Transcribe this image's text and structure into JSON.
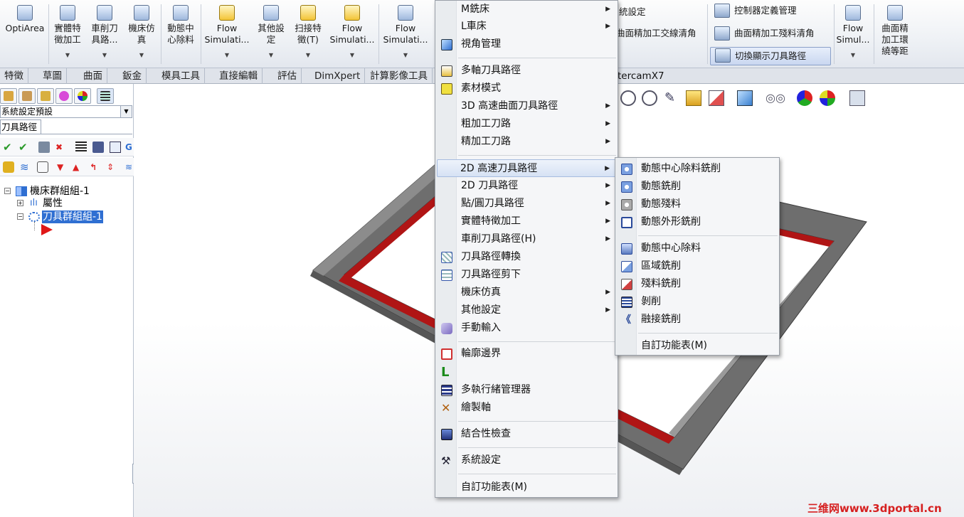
{
  "colors": {
    "accent": "#2f6fd2",
    "menu_bg": "#f5f6f8",
    "highlight": "#d6e2f4",
    "part_gray": "#7a7a7a",
    "part_red": "#a01818"
  },
  "ribbon": {
    "buttons": [
      {
        "label": "OptiArea",
        "icon": "optiarea-icon"
      },
      {
        "label": "實體特\n徵加工",
        "icon": "solid-feature-icon"
      },
      {
        "label": "車削刀\n具路...",
        "icon": "lathe-toolpath-icon"
      },
      {
        "label": "機床仿\n真",
        "icon": "machine-sim-icon"
      },
      {
        "label": "動態中\n心除料",
        "icon": "dynamic-core-icon"
      },
      {
        "label": "Flow\nSimulati...",
        "icon": "flow-sim-icon"
      },
      {
        "label": "其他設\n定",
        "icon": "other-settings-icon"
      },
      {
        "label": "扫接特\n徵(T)",
        "icon": "sweep-feature-icon"
      },
      {
        "label": "Flow\nSimulati...",
        "icon": "flow-sim-2-icon"
      },
      {
        "label": "Flow\nSimulati...",
        "icon": "flow-sim-3-icon"
      }
    ],
    "right_items": [
      {
        "label": "統設定"
      },
      {
        "label": "曲面精加工交線清角"
      },
      {
        "label": "控制器定義管理"
      },
      {
        "label": "曲面精加工殘料清角"
      },
      {
        "label": "切換顯示刀具路徑"
      }
    ],
    "right_buttons": [
      {
        "label": "Flow\nSimul..."
      },
      {
        "label": "曲面精\n加工環\n繞等距"
      }
    ]
  },
  "tabs": [
    "特徵",
    "草圖",
    "曲面",
    "鈑金",
    "模具工具",
    "直接編輯",
    "評估",
    "DimXpert",
    "計算影像工具"
  ],
  "viewport_tab": "tercamX7",
  "left_panel": {
    "dropdown": "系統設定預設",
    "subtab": "刀具路徑",
    "tree": [
      {
        "label": "機床群組組-1",
        "expander": "-"
      },
      {
        "label": "屬性",
        "expander": "+"
      },
      {
        "label": "刀具群組組-1",
        "expander": "-"
      }
    ]
  },
  "main_menu": {
    "items": [
      {
        "label": "M銑床",
        "submenu": true
      },
      {
        "label": "L車床",
        "submenu": true
      },
      {
        "label": "視角管理",
        "submenu": false,
        "icon": "cube-icon"
      },
      {
        "label": "多軸刀具路徑",
        "submenu": false,
        "icon": "multiaxis-icon"
      },
      {
        "label": "素材模式",
        "submenu": false,
        "icon": "stock-icon"
      },
      {
        "label": "3D 高速曲面刀具路徑",
        "submenu": true
      },
      {
        "label": "粗加工刀路",
        "submenu": true
      },
      {
        "label": "精加工刀路",
        "submenu": true
      },
      {
        "label": "2D 高速刀具路徑",
        "submenu": true
      },
      {
        "label": "2D 刀具路徑",
        "submenu": true
      },
      {
        "label": "點/圓刀具路徑",
        "submenu": true
      },
      {
        "label": "實體特徵加工",
        "submenu": true
      },
      {
        "label": "車削刀具路徑(H)",
        "submenu": true
      },
      {
        "label": "刀具路徑轉換",
        "submenu": false,
        "icon": "transform-icon"
      },
      {
        "label": "刀具路徑剪下",
        "submenu": false,
        "icon": "trim-icon"
      },
      {
        "label": "機床仿真",
        "submenu": true
      },
      {
        "label": "其他設定",
        "submenu": true
      },
      {
        "label": "手動輸入",
        "submenu": false,
        "icon": "manual-entry-icon"
      },
      {
        "label": "輪廓邊界",
        "submenu": false,
        "icon": "contour-boundary-icon"
      },
      {
        "label": "多執行緒管理器",
        "submenu": false,
        "icon": "multithread-icon"
      },
      {
        "label": "繪製軸",
        "submenu": false,
        "icon": "draw-axis-icon"
      },
      {
        "label": "結合性檢查",
        "submenu": false,
        "icon": "check-icon"
      },
      {
        "label": "系統設定",
        "submenu": false,
        "icon": "settings-icon"
      },
      {
        "label": "自訂功能表(M)",
        "submenu": false
      }
    ],
    "highlighted": "2D 高速刀具路徑"
  },
  "sub_menu": {
    "items": [
      {
        "label": "動態中心除料銑削",
        "icon": "dyn-core-mill-icon"
      },
      {
        "label": "動態銑削",
        "icon": "dyn-mill-icon"
      },
      {
        "label": "動態殘料",
        "icon": "dyn-rest-icon"
      },
      {
        "label": "動態外形銑削",
        "icon": "dyn-contour-icon"
      },
      {
        "label": "動態中心除料",
        "icon": "dyn-core-icon"
      },
      {
        "label": "區域銑削",
        "icon": "area-mill-icon"
      },
      {
        "label": "殘料銑削",
        "icon": "rest-mill-icon"
      },
      {
        "label": "剝削",
        "icon": "peel-mill-icon"
      },
      {
        "label": "融接銑削",
        "icon": "blend-mill-icon"
      },
      {
        "label": "自訂功能表(M)",
        "icon": ""
      }
    ]
  },
  "watermark": "三维网www.3dportal.cn"
}
